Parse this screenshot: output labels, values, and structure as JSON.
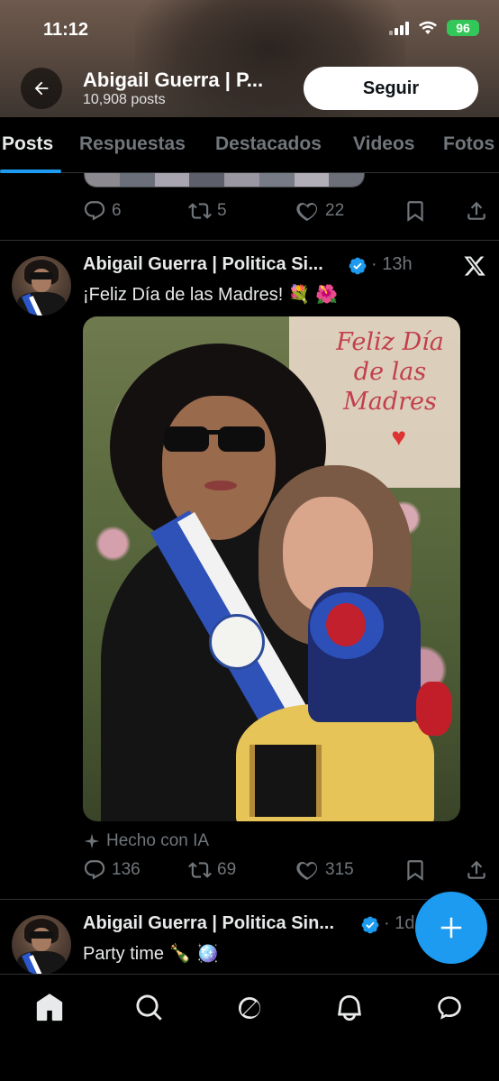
{
  "status": {
    "time": "11:12",
    "battery": "96"
  },
  "header": {
    "name": "Abigail Guerra | P...",
    "posts": "10,908 posts",
    "follow": "Seguir"
  },
  "tabs": [
    {
      "label": "Posts",
      "active": true
    },
    {
      "label": "Respuestas"
    },
    {
      "label": "Destacados"
    },
    {
      "label": "Videos"
    },
    {
      "label": "Fotos"
    }
  ],
  "prev_tweet": {
    "replies": "6",
    "reposts": "5",
    "likes": "22"
  },
  "tweet1": {
    "author": "Abigail Guerra | Politica Si...",
    "time": "· 13h",
    "text": "¡Feliz Día de las Madres! 💐 🌺",
    "card_title": "Feliz Día de las Madres",
    "ai_label": "Hecho con IA",
    "replies": "136",
    "reposts": "69",
    "likes": "315"
  },
  "tweet2": {
    "author": "Abigail Guerra | Politica Sin...",
    "time": "· 1d",
    "text": "Party time 🍾 🪩"
  },
  "colors": {
    "accent": "#1d9bf0",
    "muted": "#71767b"
  },
  "icons": [
    "back-arrow-icon",
    "reply-icon",
    "repost-icon",
    "like-icon",
    "bookmark-icon",
    "share-icon",
    "x-logo-icon",
    "verified-icon",
    "sparkle-icon",
    "plus-icon",
    "home-icon",
    "search-icon",
    "grok-icon",
    "notifications-icon",
    "messages-icon"
  ]
}
